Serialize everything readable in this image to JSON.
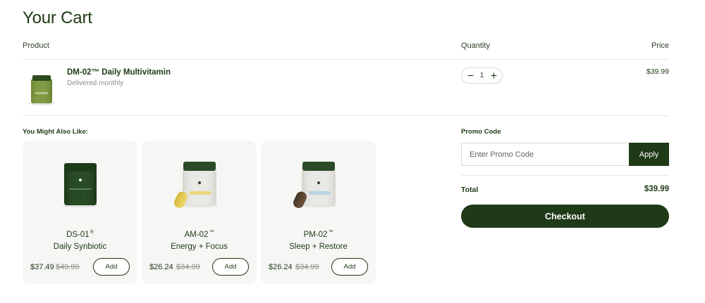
{
  "page": {
    "title": "Your Cart"
  },
  "table": {
    "col_product": "Product",
    "col_quantity": "Quantity",
    "col_price": "Price"
  },
  "cart_item": {
    "name": "DM-02™ Daily Multivitamin",
    "subtitle": "Delivered monthly",
    "quantity": "1",
    "price": "$39.99",
    "image_icon": "green-supplement-jar",
    "minus_icon": "minus-icon",
    "plus_icon": "plus-icon"
  },
  "recommendations": {
    "label": "You Might Also Like:",
    "items": [
      {
        "code": "DS-01",
        "mark": "®",
        "name": "Daily Synbiotic",
        "sale_price": "$37.49",
        "original_price": "$49.99",
        "add_label": "Add",
        "image_icon": "dark-green-jar"
      },
      {
        "code": "AM-02",
        "mark": "™",
        "name": "Energy + Focus",
        "sale_price": "$26.24",
        "original_price": "$34.99",
        "add_label": "Add",
        "image_icon": "clear-jar-yellow-capsule"
      },
      {
        "code": "PM-02",
        "mark": "™",
        "name": "Sleep + Restore",
        "sale_price": "$26.24",
        "original_price": "$34.99",
        "add_label": "Add",
        "image_icon": "clear-jar-brown-capsule"
      }
    ]
  },
  "promo": {
    "label": "Promo Code",
    "placeholder": "Enter Promo Code",
    "apply_label": "Apply"
  },
  "summary": {
    "total_label": "Total",
    "total_value": "$39.99",
    "checkout_label": "Checkout"
  },
  "colors": {
    "brand_dark_green": "#1f3a17",
    "card_bg": "#f6f6f4",
    "muted_text": "#8a8f86",
    "divider": "#e6e6e2"
  }
}
